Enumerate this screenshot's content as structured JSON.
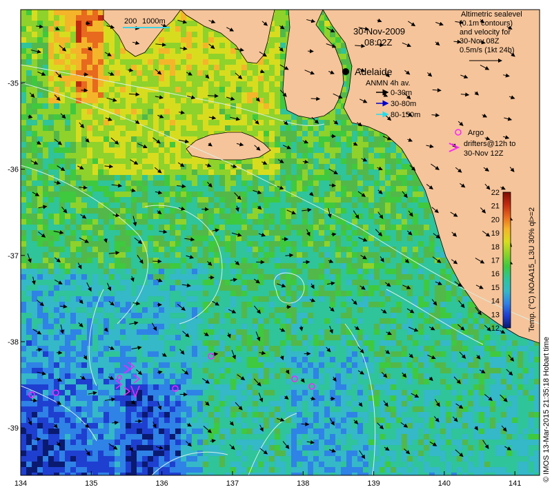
{
  "map": {
    "date": "30-Nov-2009",
    "time": "08:02Z",
    "x_ticks": [
      "134",
      "135",
      "136",
      "137",
      "138",
      "139",
      "140",
      "141"
    ],
    "y_ticks": [
      "-35",
      "-36",
      "-37",
      "-38",
      "-39"
    ],
    "x_range": [
      134,
      141.35
    ],
    "y_range": [
      -39.55,
      -34.15
    ],
    "depth_scale": [
      "200",
      "1000m"
    ],
    "place_label": "Adelaide"
  },
  "legend_sealevel": {
    "lines": [
      "Altimetric sealevel",
      "(0.1m contours)",
      "and velocity for",
      "30-Nov 08Z",
      "0.5m/s (1kt 24h)"
    ]
  },
  "legend_anmn": {
    "title": "ANMN 4h av.",
    "items": [
      {
        "label": "0-30m",
        "color": "#000000"
      },
      {
        "label": "30-80m",
        "color": "#0000cc"
      },
      {
        "label": "80-150m",
        "color": "#22ddee"
      }
    ]
  },
  "legend_argo": {
    "label": "Argo",
    "drifters_lines": [
      "drifters@12h to",
      "30-Nov 12Z"
    ],
    "color": "#ff22ff"
  },
  "colorbar": {
    "ticks": [
      "12",
      "13",
      "14",
      "15",
      "16",
      "17",
      "18",
      "19",
      "20",
      "21",
      "22"
    ],
    "label": "Temp. (°C) NOAA15_L3U 30% ql>=2",
    "stops": [
      "#0a1a70",
      "#1f3fd0",
      "#2f82e6",
      "#35b8c8",
      "#2fc49a",
      "#3fc93e",
      "#8ed22b",
      "#d8dc1f",
      "#f5b52a",
      "#e86a1e",
      "#c22a10",
      "#7d0d05"
    ]
  },
  "credit": "© IMOS 13-Mar-2015 21:35:18 Hobart time",
  "colors": {
    "land": "#f6c49a",
    "sea_bg": "#52b84a",
    "contour": "#d8f0e8",
    "argo": "#ff22ff"
  }
}
